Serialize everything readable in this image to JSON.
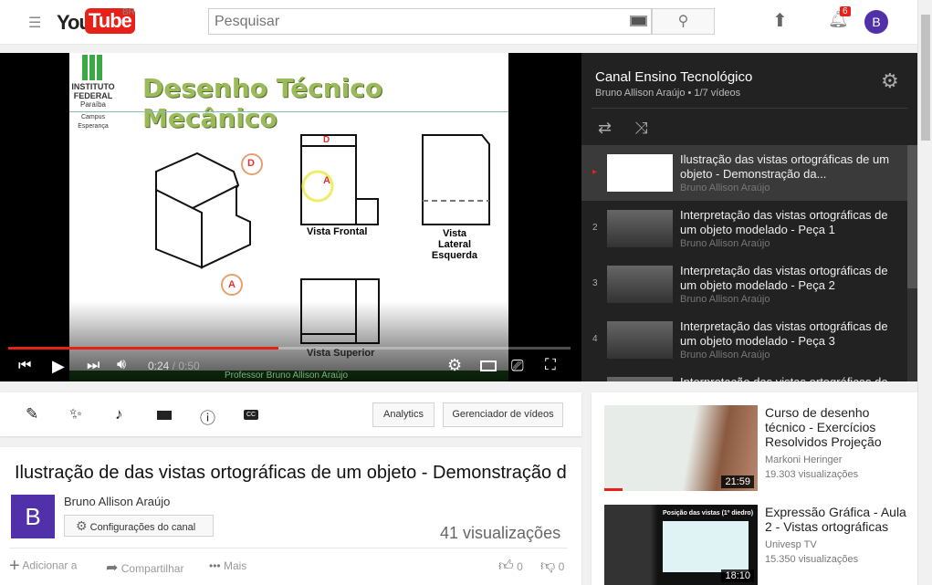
{
  "header": {
    "logo_you": "You",
    "logo_tube": "Tube",
    "logo_region": "BR",
    "search_placeholder": "Pesquisar",
    "notifications_count": "6",
    "avatar_letter": "B"
  },
  "player": {
    "slide": {
      "title": "Desenho Técnico Mecânico",
      "logo_lines": [
        "INSTITUTO",
        "FEDERAL",
        "Paraíba",
        "Campus",
        "Esperança"
      ],
      "labels": {
        "front": "Vista Frontal",
        "left1": "Vista Lateral",
        "left2": "Esquerda",
        "top": "Vista Superior",
        "d": "D",
        "a": "A",
        "footer": "Professor Bruno Allison Araújo"
      }
    },
    "time_current": "0:24",
    "time_total": "0:50",
    "time_sep": " / ",
    "progress": 0.48
  },
  "playlist": {
    "title": "Canal Ensino Tecnológico",
    "subtitle": "Bruno Allison Araújo • 1/7 vídeos",
    "items": [
      {
        "num": "▸",
        "title": "Ilustração das vistas ortográficas de um objeto - Demonstração da...",
        "channel": "Bruno Allison Araújo",
        "active": true
      },
      {
        "num": "2",
        "title": "Interpretação das vistas ortográficas de um objeto modelado - Peça 1",
        "channel": "Bruno Allison Araújo"
      },
      {
        "num": "3",
        "title": "Interpretação das vistas ortográficas de um objeto modelado - Peça 2",
        "channel": "Bruno Allison Araújo"
      },
      {
        "num": "4",
        "title": "Interpretação das vistas ortográficas de um objeto modelado - Peça 3",
        "channel": "Bruno Allison Araújo"
      },
      {
        "num": "5",
        "title": "Interpretação das vistas ortográficas de",
        "channel": ""
      }
    ]
  },
  "toolbar": {
    "analytics": "Analytics",
    "manager": "Gerenciador de vídeos"
  },
  "video": {
    "title": "Ilustração de das vistas ortográficas de um objeto - Demonstração d",
    "channel": "Bruno Allison Araújo",
    "avatar_letter": "B",
    "settings_button": "Configurações do canal",
    "views": "41 visualizações",
    "add": "Adicionar a",
    "share": "Compartilhar",
    "more": "Mais",
    "likes": "0",
    "dislikes": "0"
  },
  "recommended": [
    {
      "title": "Curso de desenho técnico - Exercícios Resolvidos Projeção",
      "channel": "Markoni Heringer",
      "views": "19.303 visualizações",
      "duration": "21:59"
    },
    {
      "title": "Expressão Gráfica - Aula 2 - Vistas ortográficas",
      "channel": "Univesp TV",
      "views": "15.350 visualizações",
      "duration": "18:10",
      "thumb_caption": "Posição das vistas (1º diedro)"
    }
  ],
  "colors": {
    "brand": "#e62117",
    "avatar": "#5131a9",
    "progress": "#e62117",
    "slide_title": "#9bbb59"
  }
}
